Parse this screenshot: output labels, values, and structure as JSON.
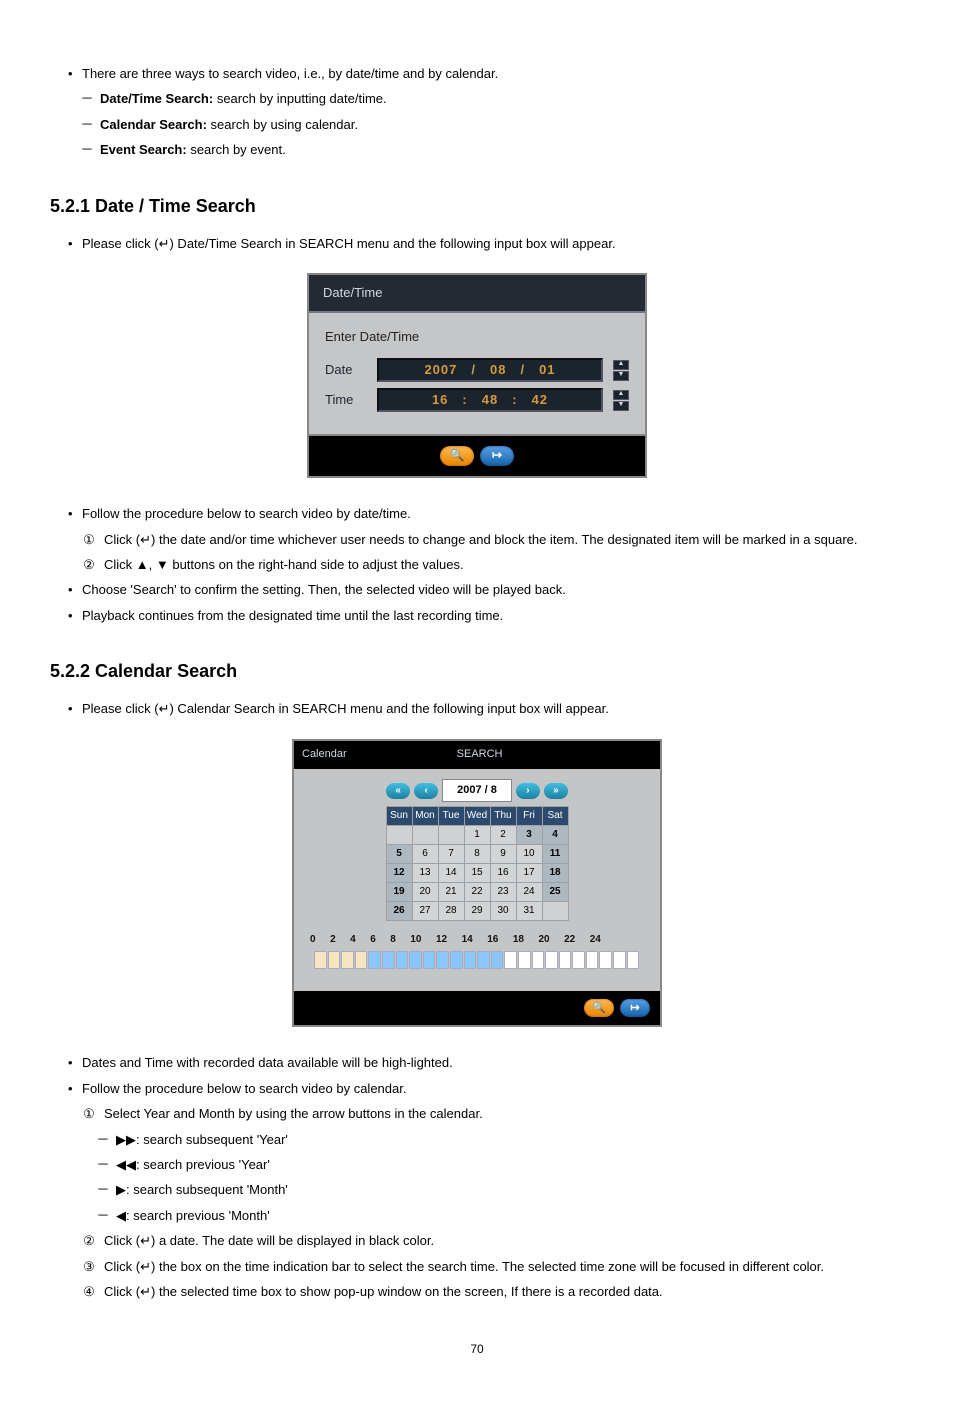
{
  "intro": {
    "bullet1": "There are three ways to search video, i.e., by date/time and by calendar.",
    "dt_label": "Date/Time Search:",
    "dt_desc": " search by inputting date/time.",
    "cal_label": "Calendar Search:",
    "cal_desc": " search by using calendar.",
    "ev_label": "Event Search:",
    "ev_desc": " search by event."
  },
  "sec521": {
    "heading": "5.2.1  Date / Time Search",
    "lead_a": "Please click (",
    "enter_g": "↵",
    "lead_b": ") Date/Time Search in SEARCH menu and the following input box will appear."
  },
  "dt_panel": {
    "title": "Date/Time",
    "sub": "Enter Date/Time",
    "date_label": "Date",
    "time_label": "Time",
    "date": {
      "yyyy": "2007",
      "mm": "08",
      "dd": "01",
      "sep": "/"
    },
    "time": {
      "hh": "16",
      "mm": "48",
      "ss": "42",
      "sep": ":"
    },
    "spin_up": "▲",
    "spin_dn": "▼",
    "icon_search": "🔍",
    "icon_exit": "↦"
  },
  "proc521": {
    "p1": "Follow the procedure below to search video by date/time.",
    "s1a": "Click (",
    "s1b": ") the date and/or time whichever user needs to change and block the item. The designated item will be marked in a square.",
    "s2": "Click ▲, ▼ buttons on the right-hand side to adjust the values.",
    "p2": "Choose 'Search' to confirm the setting. Then, the selected video will be played back.",
    "p3": "Playback continues from the designated time until the last recording time."
  },
  "sec522": {
    "heading": "5.2.2  Calendar Search",
    "lead_a": "Please click (",
    "lead_b": ") Calendar Search in SEARCH menu and the following input box will appear."
  },
  "cal_panel": {
    "title_left": "Calendar",
    "title_center": "SEARCH",
    "nav_pp": "«",
    "nav_p": "‹",
    "nav_n": "›",
    "nav_nn": "»",
    "period": "2007 / 8",
    "days": [
      "Sun",
      "Mon",
      "Tue",
      "Wed",
      "Thu",
      "Fri",
      "Sat"
    ],
    "grid": [
      [
        "",
        "",
        "",
        "1",
        "2",
        "3",
        "4"
      ],
      [
        "5",
        "6",
        "7",
        "8",
        "9",
        "10",
        "11"
      ],
      [
        "12",
        "13",
        "14",
        "15",
        "16",
        "17",
        "18"
      ],
      [
        "19",
        "20",
        "21",
        "22",
        "23",
        "24",
        "25"
      ],
      [
        "26",
        "27",
        "28",
        "29",
        "30",
        "31",
        ""
      ]
    ],
    "weekend_bold": [
      3,
      4,
      5,
      11,
      12,
      18,
      19,
      25,
      26
    ],
    "hours": [
      "0",
      "2",
      "4",
      "6",
      "8",
      "10",
      "12",
      "14",
      "16",
      "18",
      "20",
      "22",
      "24"
    ],
    "icon_search": "🔍",
    "icon_exit": "↦"
  },
  "proc522": {
    "p1": "Dates and Time with recorded data available will be high-lighted.",
    "p2": "Follow the procedure below to search video by calendar.",
    "s1": "Select Year and Month by using the arrow buttons in the calendar.",
    "s1a_sym": "▶▶",
    "s1a": ": search subsequent 'Year'",
    "s1b_sym": "◀◀",
    "s1b": ": search previous 'Year'",
    "s1c_sym": "▶",
    "s1c": ": search subsequent 'Month'",
    "s1d_sym": "◀",
    "s1d": ": search previous 'Month'",
    "s2a": "Click (",
    "s2b": ") a date. The date will be displayed in black color.",
    "s3a": "Click (",
    "s3b": ")   the box on the time indication bar to select the search time. The selected time zone will be focused in different color.",
    "s4a": "Click (",
    "s4b": ") the selected time box to show pop-up window on the screen, If there is a recorded data."
  },
  "glyphs": {
    "dash": "－",
    "dot": "•",
    "n1": "①",
    "n2": "②",
    "n3": "③",
    "n4": "④"
  },
  "page": "70"
}
